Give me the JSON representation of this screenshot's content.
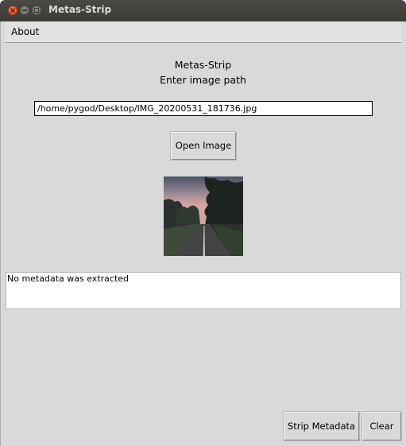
{
  "window": {
    "title": "Metas-Strip"
  },
  "menu": {
    "about_label": "About"
  },
  "header": {
    "title": "Metas-Strip",
    "subtitle": "Enter image path"
  },
  "path_input": {
    "value": "/home/pygod/Desktop/IMG_20200531_181736.jpg"
  },
  "buttons": {
    "open_image": "Open Image",
    "strip_metadata": "Strip Metadata",
    "clear": "Clear"
  },
  "output": {
    "text": "No metadata was extracted"
  },
  "colors": {
    "titlebar": "#3c3b37",
    "close_button": "#df4a16",
    "window_bg": "#d9d9d9"
  }
}
